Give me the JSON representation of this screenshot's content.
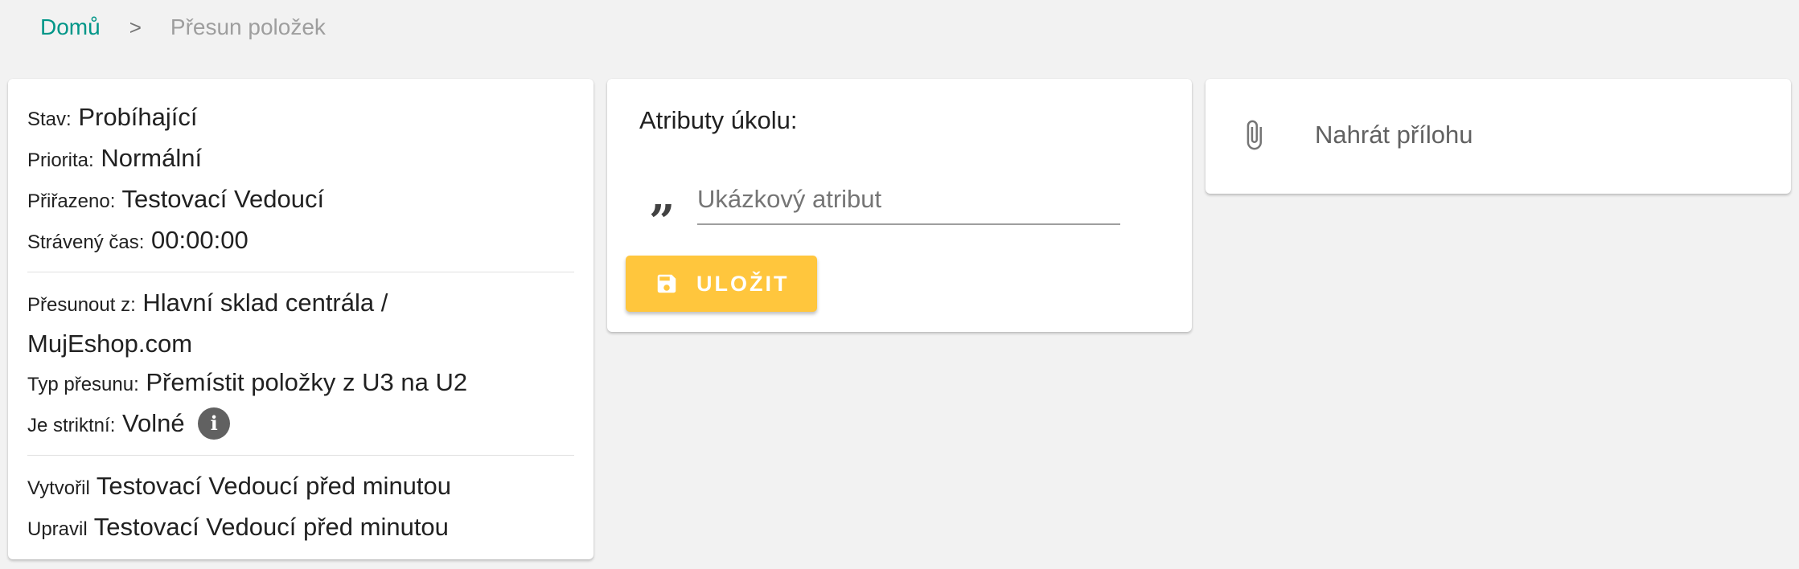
{
  "breadcrumb": {
    "home": "Domů",
    "separator": ">",
    "current": "Přesun položek"
  },
  "info": {
    "status_label": "Stav:",
    "status_value": "Probíhající",
    "priority_label": "Priorita:",
    "priority_value": "Normální",
    "assigned_label": "Přiřazeno:",
    "assigned_value": "Testovací Vedoucí",
    "time_label": "Strávený čas:",
    "time_value": "00:00:00",
    "move_from_label": "Přesunout z:",
    "move_from_value_1": "Hlavní sklad centrála /",
    "move_from_value_2": "MujEshop.com",
    "move_type_label": "Typ přesunu:",
    "move_type_value": "Přemístit položky z U3 na U2",
    "strict_label": "Je striktní:",
    "strict_value": "Volné",
    "created_label": "Vytvořil",
    "created_value": "Testovací Vedoucí před minutou",
    "updated_label": "Upravil",
    "updated_value": "Testovací Vedoucí před minutou"
  },
  "attributes": {
    "title": "Atributy úkolu:",
    "input_placeholder": "Ukázkový atribut",
    "input_value": "",
    "save_label": "ULOŽIT"
  },
  "upload": {
    "label": "Nahrát přílohu"
  },
  "colors": {
    "accent_link": "#009688",
    "save_button": "#ffc63d",
    "background": "#f2f2f2"
  }
}
